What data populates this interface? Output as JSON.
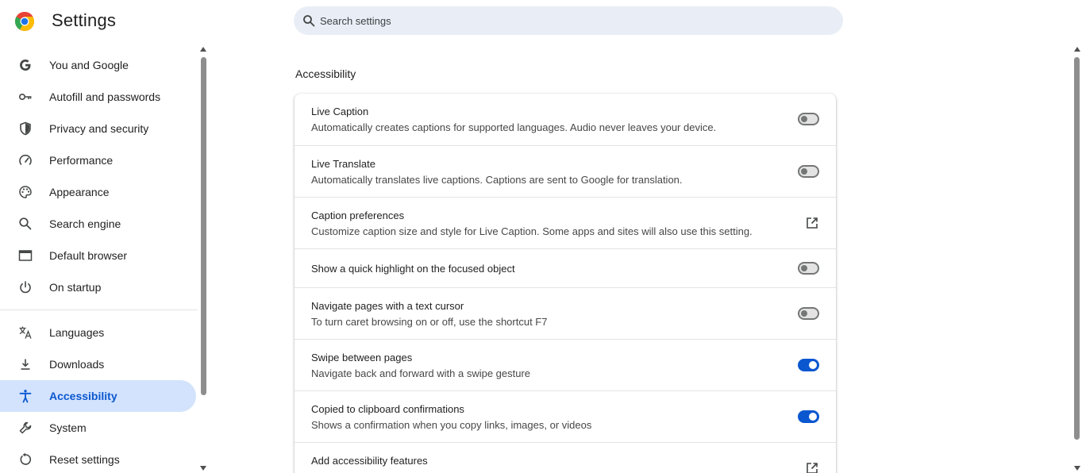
{
  "header": {
    "title": "Settings",
    "search_placeholder": "Search settings"
  },
  "sidebar": {
    "items": [
      {
        "label": "You and Google",
        "icon": "google-g-icon"
      },
      {
        "label": "Autofill and passwords",
        "icon": "key-icon"
      },
      {
        "label": "Privacy and security",
        "icon": "shield-icon"
      },
      {
        "label": "Performance",
        "icon": "speedometer-icon"
      },
      {
        "label": "Appearance",
        "icon": "palette-icon"
      },
      {
        "label": "Search engine",
        "icon": "search-icon"
      },
      {
        "label": "Default browser",
        "icon": "browser-window-icon"
      },
      {
        "label": "On startup",
        "icon": "power-icon"
      },
      {
        "label": "Languages",
        "icon": "translate-icon"
      },
      {
        "label": "Downloads",
        "icon": "download-icon"
      },
      {
        "label": "Accessibility",
        "icon": "accessibility-icon",
        "active": true
      },
      {
        "label": "System",
        "icon": "wrench-icon"
      },
      {
        "label": "Reset settings",
        "icon": "reset-icon"
      }
    ]
  },
  "main": {
    "section_title": "Accessibility",
    "rows": [
      {
        "title": "Live Caption",
        "description": "Automatically creates captions for supported languages. Audio never leaves your device.",
        "control": "toggle",
        "checked": false
      },
      {
        "title": "Live Translate",
        "description": "Automatically translates live captions. Captions are sent to Google for translation.",
        "control": "toggle",
        "checked": false
      },
      {
        "title": "Caption preferences",
        "description": "Customize caption size and style for Live Caption. Some apps and sites will also use this setting.",
        "control": "external-link"
      },
      {
        "title": "Show a quick highlight on the focused object",
        "control": "toggle",
        "checked": false
      },
      {
        "title": "Navigate pages with a text cursor",
        "description": "To turn caret browsing on or off, use the shortcut F7",
        "control": "toggle",
        "checked": false
      },
      {
        "title": "Swipe between pages",
        "description": "Navigate back and forward with a swipe gesture",
        "control": "toggle",
        "checked": true
      },
      {
        "title": "Copied to clipboard confirmations",
        "description": "Shows a confirmation when you copy links, images, or videos",
        "control": "toggle",
        "checked": true
      },
      {
        "title": "Add accessibility features",
        "control": "external-link"
      }
    ]
  },
  "colors": {
    "accent": "#0b57d0",
    "active_nav_bg": "#d3e3fd",
    "search_bg": "#e9eef6"
  }
}
